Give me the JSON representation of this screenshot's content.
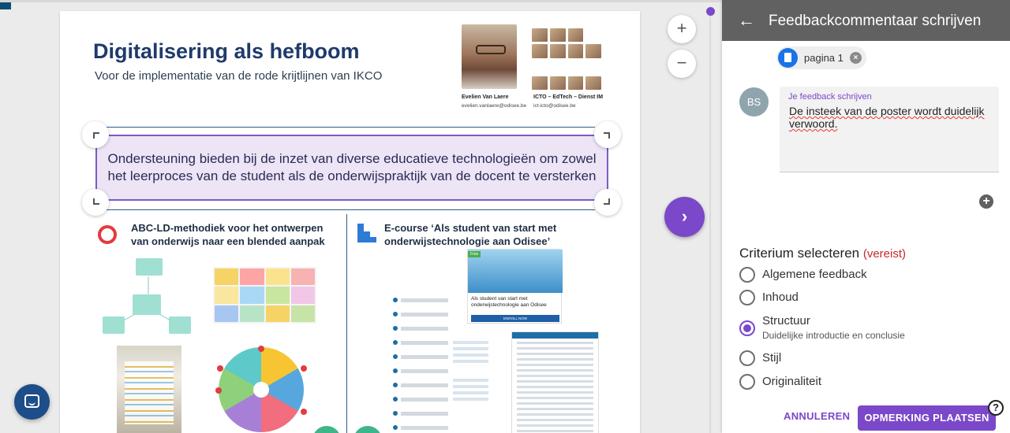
{
  "poster": {
    "title": "Digitalisering als hefboom",
    "subtitle": "Voor de implementatie van de rode krijtlijnen van IKCO",
    "author_name": "Evelien Van Laere",
    "author_email": "evelien.vanlaere@odisee.be",
    "team_name": "ICTO – EdTech – Dienst IM",
    "team_email": "ict-icto@odisee.be",
    "banner": "Ondersteuning bieden bij de inzet van diverse educatieve technologieën om zowel het leerproces van de student als de onderwijspraktijk van de docent te versterken",
    "left_heading": "ABC-LD-methodiek voor het ontwerpen van onderwijs naar een blended aanpak",
    "right_heading": "E-course ‘Als student van start met onderwijstechnologie aan Odisee’",
    "course_card_text": "Als student van start met onderwijstechnologie aan Odisee",
    "course_card_button": "ENROLL NOW",
    "course_card_badge": "Free"
  },
  "zoom": {
    "in_label": "+",
    "out_label": "−"
  },
  "nav": {
    "next_label": "›"
  },
  "panel": {
    "title": "Feedbackcommentaar schrijven",
    "page_chip": "pagina 1",
    "avatar_initials": "BS",
    "feedback_label": "Je feedback schrijven",
    "feedback_text": "De insteek van de poster wordt duidelijk verwoord.",
    "add_label": "+",
    "criterium_heading": "Criterium selecteren",
    "criterium_required": "(vereist)",
    "criteria": [
      {
        "label": "Algemene feedback",
        "desc": "",
        "checked": false
      },
      {
        "label": "Inhoud",
        "desc": "",
        "checked": false
      },
      {
        "label": "Structuur",
        "desc": "Duidelijke introductie en conclusie",
        "checked": true
      },
      {
        "label": "Stijl",
        "desc": "",
        "checked": false
      },
      {
        "label": "Originaliteit",
        "desc": "",
        "checked": false
      }
    ],
    "cancel_label": "ANNULEREN",
    "submit_label": "OPMERKING PLAATSEN",
    "help_label": "?"
  },
  "colors": {
    "accent": "#7b48c9",
    "panel_header": "#616161",
    "poster_title": "#1f3a6b",
    "chat_button": "#1d4e89"
  },
  "icons": {
    "back": "arrow-left-icon",
    "page": "document-icon",
    "close": "close-circle-icon",
    "add": "add-circle-icon",
    "help": "help-circle-icon",
    "chat": "chat-bubble-icon",
    "next": "chevron-right-icon"
  }
}
